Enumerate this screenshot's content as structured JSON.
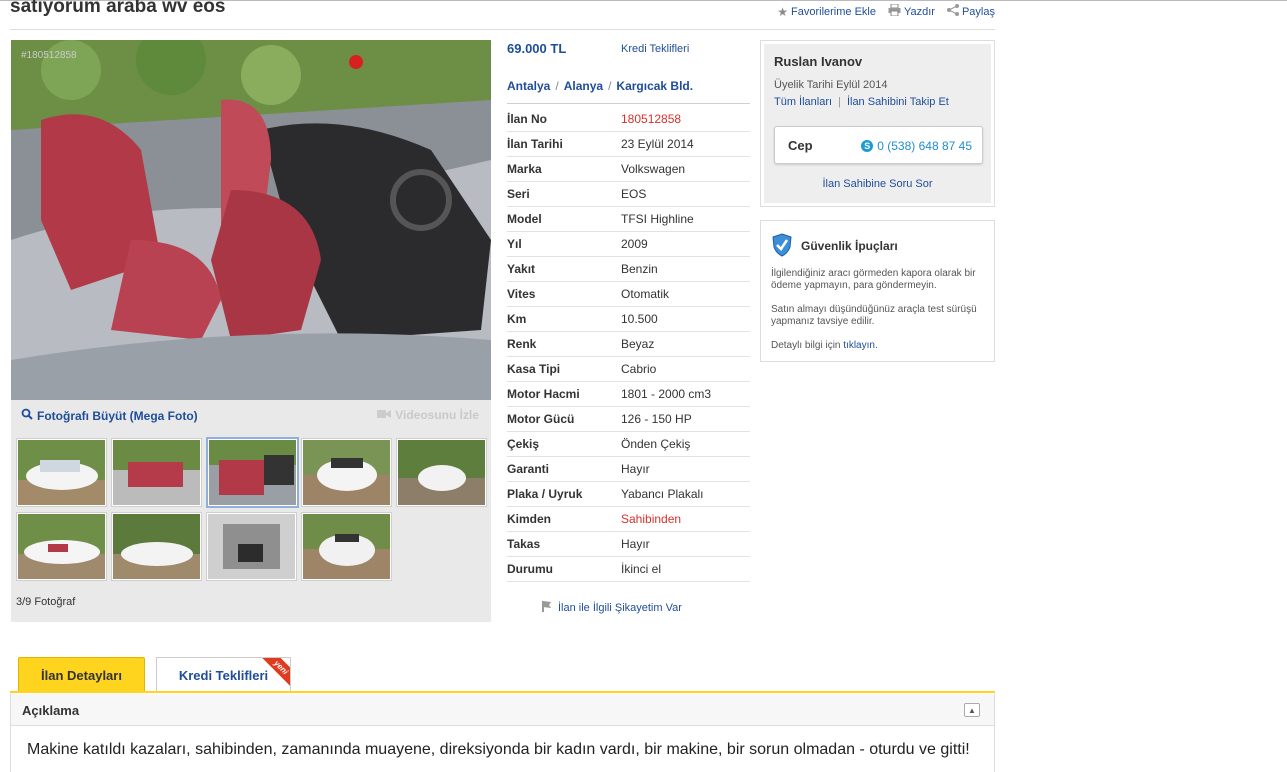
{
  "listing": {
    "title": "satıyorum araba wv eos",
    "actions": {
      "favorite": "Favorilerime Ekle",
      "print": "Yazdır",
      "share": "Paylaş"
    }
  },
  "gallery": {
    "photo_id": "#180512858",
    "mega_foto": "Fotoğrafı Büyüt (Mega Foto)",
    "video": "Videosunu İzle",
    "count": "3/9 Fotoğraf",
    "selected_index": 2
  },
  "summary": {
    "price": "69.000 TL",
    "credit_link": "Kredi Teklifleri",
    "location": [
      "Antalya",
      "Alanya",
      "Kargıcak Bld."
    ],
    "location_sep": "/"
  },
  "details": [
    {
      "label": "İlan No",
      "value": "180512858",
      "highlight": true
    },
    {
      "label": "İlan Tarihi",
      "value": "23 Eylül 2014"
    },
    {
      "label": "Marka",
      "value": "Volkswagen"
    },
    {
      "label": "Seri",
      "value": "EOS"
    },
    {
      "label": "Model",
      "value": "TFSI Highline"
    },
    {
      "label": "Yıl",
      "value": "2009"
    },
    {
      "label": "Yakıt",
      "value": "Benzin"
    },
    {
      "label": "Vites",
      "value": "Otomatik"
    },
    {
      "label": "Km",
      "value": "10.500"
    },
    {
      "label": "Renk",
      "value": "Beyaz"
    },
    {
      "label": "Kasa Tipi",
      "value": "Cabrio"
    },
    {
      "label": "Motor Hacmi",
      "value": "1801 - 2000 cm3"
    },
    {
      "label": "Motor Gücü",
      "value": "126 - 150 HP"
    },
    {
      "label": "Çekiş",
      "value": "Önden Çekiş"
    },
    {
      "label": "Garanti",
      "value": "Hayır"
    },
    {
      "label": "Plaka / Uyruk",
      "value": "Yabancı Plakalı"
    },
    {
      "label": "Kimden",
      "value": "Sahibinden",
      "highlight": true
    },
    {
      "label": "Takas",
      "value": "Hayır"
    },
    {
      "label": "Durumu",
      "value": "İkinci el"
    }
  ],
  "complaint": "İlan ile İlgili Şikayetim Var",
  "seller": {
    "name": "Ruslan Ivanov",
    "member_since": "Üyelik Tarihi  Eylül 2014",
    "all_ads": "Tüm İlanları",
    "follow": "İlan Sahibini Takip Et",
    "phone_label": "Cep",
    "phone": "0 (538) 648 87 45",
    "ask": "İlan Sahibine Soru Sor"
  },
  "tips": {
    "title": "Güvenlik İpuçları",
    "p1": "İlgilendiğiniz aracı görmeden kapora olarak bir ödeme yapmayın, para göndermeyin.",
    "p2": "Satın almayı düşündüğünüz araçla test sürüşü yapmanız tavsiye edilir.",
    "p3_prefix": "Detaylı bilgi için ",
    "p3_link": "tıklayın",
    "p3_suffix": "."
  },
  "tabs": {
    "details": "İlan Detayları",
    "credit": "Kredi Teklifleri",
    "new_badge": "yeni"
  },
  "description": {
    "title": "Açıklama",
    "text": "Makine katıldı kazaları, sahibinden, zamanında muayene, direksiyonda bir kadın vardı, bir makine, bir sorun olmadan - oturdu ve gitti!"
  },
  "colors": {
    "link": "#1f4d99",
    "highlight": "#d6302b",
    "tab_active": "#ffd41e",
    "panel_bg": "#e9e9e9"
  }
}
